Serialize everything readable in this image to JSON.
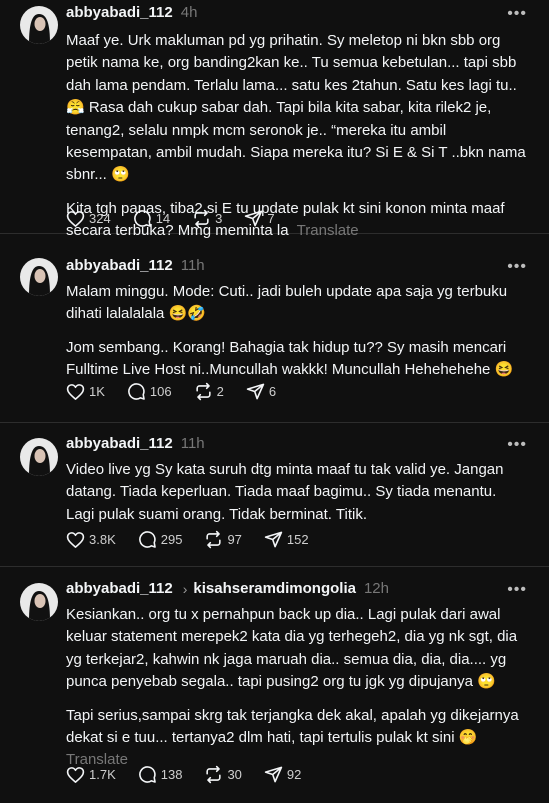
{
  "posts": [
    {
      "username": "abbyabadi_112",
      "time": "4h",
      "paragraphs": [
        "Maaf ye. Urk makluman pd yg prihatin. Sy meletop ni bkn sbb org petik nama ke, org banding2kan ke.. Tu semua kebetulan... tapi sbb dah lama pendam. Terlalu lama... satu kes 2tahun. Satu kes lagi tu.. 😤 Rasa dah cukup sabar dah. Tapi bila kita sabar, kita rilek2 je, tenang2, selalu nmpk mcm seronok je.. “mereka itu ambil kesempatan, ambil mudah. Siapa mereka itu? Si E & Si T ..bkn nama sbnr... 🙄",
        "Kita tgh panas, tiba2 si E tu update pulak kt sini konon minta maaf secara terbuka? Mmg meminta la"
      ],
      "translate": "Translate",
      "likes": "324",
      "replies": "14",
      "reposts": "3",
      "shares": "7"
    },
    {
      "username": "abbyabadi_112",
      "time": "11h",
      "paragraphs": [
        "Malam minggu. Mode: Cuti.. jadi buleh update apa saja yg terbuku dihati lalalalala 😆🤣",
        "Jom sembang.. Korang! Bahagia tak hidup tu?? Sy masih mencari Fulltime Live Host ni..Muncullah wakkk! Muncullah Hehehehehe 😆"
      ],
      "likes": "1K",
      "replies": "106",
      "reposts": "2",
      "shares": "6"
    },
    {
      "username": "abbyabadi_112",
      "time": "11h",
      "paragraphs": [
        "Video live yg Sy kata suruh dtg minta maaf tu tak valid ye. Jangan datang. Tiada keperluan. Tiada maaf bagimu.. Sy tiada menantu. Lagi pulak suami orang. Tidak berminat. Titik."
      ],
      "likes": "3.8K",
      "replies": "295",
      "reposts": "97",
      "shares": "152"
    },
    {
      "username": "abbyabadi_112",
      "reply_to": "kisahseramdimongolia",
      "time": "12h",
      "paragraphs": [
        "Kesiankan.. org tu x pernahpun back up dia.. Lagi pulak dari awal keluar statement merepek2 kata dia yg terhegeh2, dia yg nk sgt, dia yg terkejar2, kahwin nk jaga maruah dia.. semua dia, dia, dia.... yg punca penyebab segala.. tapi pusing2 org tu jgk yg dipujanya 🙄",
        "Tapi serius,sampai skrg tak terjangka dek akal, apalah yg dikejarnya dekat si e tuu... tertanya2 dlm hati, tapi tertulis pulak kt sini 🤭"
      ],
      "translate": "Translate",
      "likes": "1.7K",
      "replies": "138",
      "reposts": "30",
      "shares": "92"
    }
  ]
}
